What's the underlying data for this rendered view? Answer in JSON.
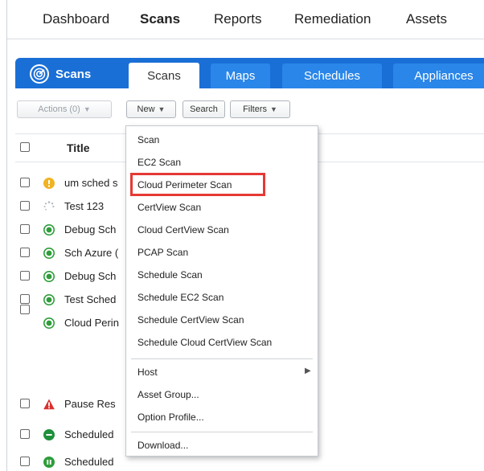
{
  "topnav": {
    "items": [
      "Dashboard",
      "Scans",
      "Reports",
      "Remediation",
      "Assets"
    ],
    "active": "Scans"
  },
  "module": {
    "title": "Scans",
    "tabs": [
      "Scans",
      "Maps",
      "Schedules",
      "Appliances"
    ],
    "active_tab": "Scans"
  },
  "toolbar": {
    "actions_label": "Actions (0)",
    "new_label": "New",
    "search_label": "Search",
    "filters_label": "Filters"
  },
  "table": {
    "header_title": "Title",
    "rows": [
      {
        "title": "um sched s",
        "status_icon": "warning-icon"
      },
      {
        "title": "Test 123",
        "status_icon": "loading-icon"
      },
      {
        "title": "Debug Sch",
        "status_icon": "finished-icon"
      },
      {
        "title": "Sch Azure (",
        "status_icon": "finished-icon"
      },
      {
        "title": "Debug Sch",
        "status_icon": "finished-icon"
      },
      {
        "title": "Test Sched",
        "status_icon": "finished-icon"
      },
      {
        "title": "Cloud Perin",
        "status_icon": "finished-icon"
      },
      {
        "title": "Pause Res",
        "status_icon": "error-icon"
      },
      {
        "title": "Scheduled",
        "status_icon": "canceled-icon"
      },
      {
        "title": "Scheduled",
        "status_icon": "paused-icon"
      }
    ]
  },
  "new_menu": {
    "items": [
      "Scan",
      "EC2 Scan",
      "Cloud Perimeter Scan",
      "CertView Scan",
      "Cloud CertView Scan",
      "PCAP Scan",
      "Schedule Scan",
      "Schedule EC2 Scan",
      "Schedule CertView Scan",
      "Schedule Cloud CertView Scan"
    ],
    "submenu_items": [
      "Host",
      "Asset Group...",
      "Option Profile..."
    ],
    "last_item": "Download...",
    "highlighted": "Cloud Perimeter Scan"
  },
  "colors": {
    "brand_blue": "#1a6fd6",
    "tab_blue": "#2a86e8",
    "highlight_red": "#e53935",
    "ok_green": "#2e9d3a",
    "warn_yellow": "#f0b323",
    "error_red": "#d9302c"
  }
}
